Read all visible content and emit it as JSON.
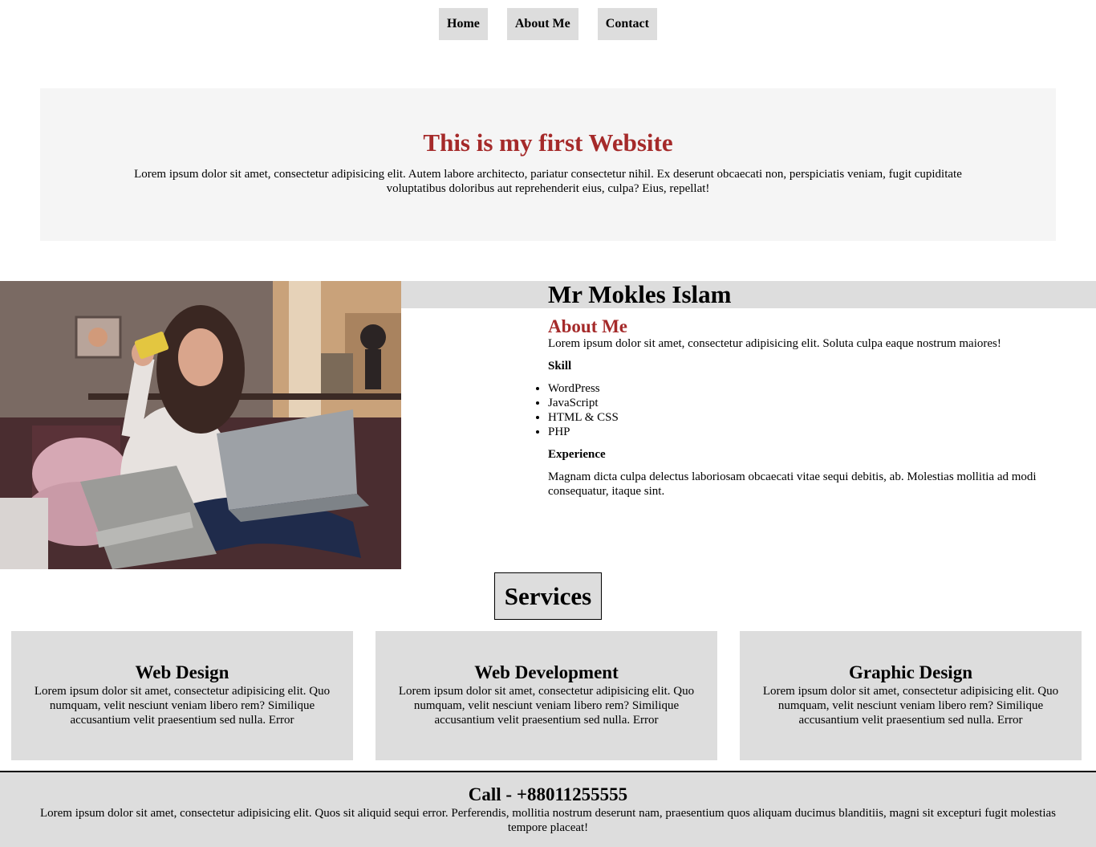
{
  "nav": {
    "items": [
      {
        "label": "Home"
      },
      {
        "label": "About Me"
      },
      {
        "label": "Contact"
      }
    ]
  },
  "hero": {
    "title": "This is my first Website",
    "text": "Lorem ipsum dolor sit amet, consectetur adipisicing elit. Autem labore architecto, pariatur consectetur nihil. Ex deserunt obcaecati non, perspiciatis veniam, fugit cupiditate voluptatibus doloribus aut reprehenderit eius, culpa? Eius, repellat!"
  },
  "about": {
    "name": "Mr Mokles Islam",
    "heading": "About Me",
    "intro": "Lorem ipsum dolor sit amet, consectetur adipisicing elit. Soluta culpa eaque nostrum maiores!",
    "skill_heading": "Skill",
    "skills": [
      "WordPress",
      "JavaScript",
      "HTML & CSS",
      "PHP"
    ],
    "experience_heading": "Experience",
    "experience_text": "Magnam dicta culpa delectus laboriosam obcaecati vitae sequi debitis, ab. Molestias mollitia ad modi consequatur, itaque sint."
  },
  "services": {
    "title": "Services",
    "cards": [
      {
        "title": "Web Design",
        "text": "Lorem ipsum dolor sit amet, consectetur adipisicing elit. Quo numquam, velit nesciunt veniam libero rem? Similique accusantium velit praesentium sed nulla. Error"
      },
      {
        "title": "Web Development",
        "text": "Lorem ipsum dolor sit amet, consectetur adipisicing elit. Quo numquam, velit nesciunt veniam libero rem? Similique accusantium velit praesentium sed nulla. Error"
      },
      {
        "title": "Graphic Design",
        "text": "Lorem ipsum dolor sit amet, consectetur adipisicing elit. Quo numquam, velit nesciunt veniam libero rem? Similique accusantium velit praesentium sed nulla. Error"
      }
    ]
  },
  "footer": {
    "call": "Call - +88011255555",
    "text": "Lorem ipsum dolor sit amet, consectetur adipisicing elit. Quos sit aliquid sequi error. Perferendis, mollitia nostrum deserunt nam, praesentium quos aliquam ducimus blanditiis, magni sit excepturi fugit molestias tempore placeat!"
  },
  "colors": {
    "accent": "#a52a2a",
    "panel": "#dddddd",
    "hero_bg": "#f5f5f5"
  }
}
